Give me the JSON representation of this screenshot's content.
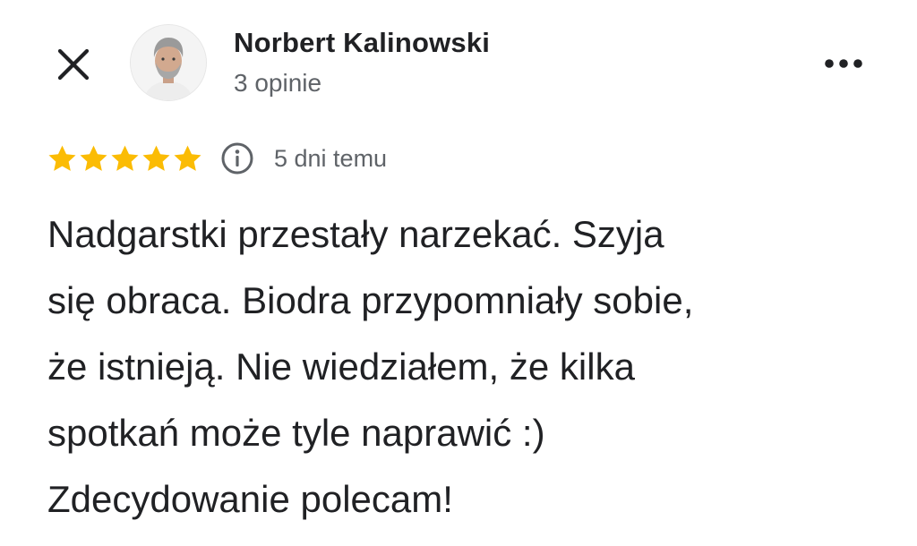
{
  "header": {
    "close_icon": "close-icon",
    "more_icon": "more-horizontal-icon"
  },
  "reviewer": {
    "name": "Norbert Kalinowski",
    "review_count": "3 opinie",
    "avatar": "avatar-photo"
  },
  "rating": {
    "stars": 5,
    "max_stars": 5,
    "star_color": "#fbbc04",
    "info_icon": "info-icon",
    "date": "5 dni temu"
  },
  "review": {
    "lines": [
      "Nadgarstki przestały narzekać. Szyja",
      "się obraca. Biodra przypomniały sobie,",
      "że istnieją. Nie wiedziałem, że kilka",
      "spotkań może tyle naprawić :)",
      "Zdecydowanie polecam!"
    ]
  }
}
